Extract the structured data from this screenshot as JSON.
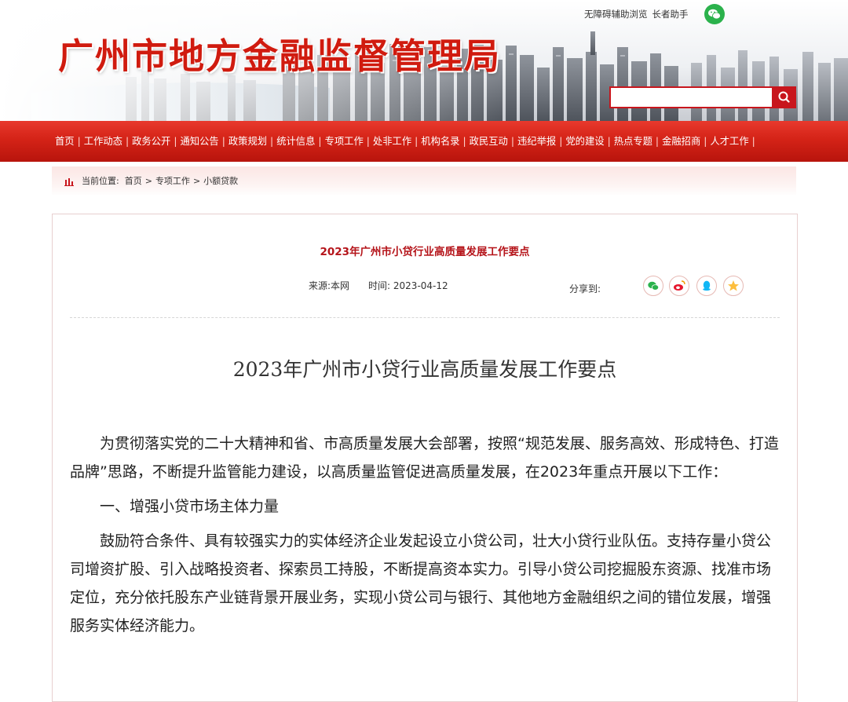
{
  "header": {
    "site_title": "广州市地方金融监督管理局",
    "accessibility_link": "无障碍辅助浏览",
    "elder_link": "长者助手",
    "wechat_icon": "wechat-icon",
    "search": {
      "value": "",
      "placeholder": "",
      "button_icon": "search-icon"
    }
  },
  "nav": {
    "items": [
      "首页",
      "工作动态",
      "政务公开",
      "通知公告",
      "政策规划",
      "统计信息",
      "专项工作",
      "处非工作",
      "机构名录",
      "政民互动",
      "违纪举报",
      "党的建设",
      "热点专题",
      "金融招商",
      "人才工作"
    ],
    "separator": "|"
  },
  "breadcrumb": {
    "label": "当前位置:",
    "items": [
      "首页",
      "专项工作",
      "小额贷款"
    ],
    "separator": ">"
  },
  "article": {
    "head_title": "2023年广州市小贷行业高质量发展工作要点",
    "source": "来源:本网",
    "time": "时间: 2023-04-12",
    "share_label": "分享到:",
    "share_icons": [
      "wechat-icon",
      "weibo-icon",
      "qq-icon",
      "qzone-icon"
    ],
    "doc_title": "2023年广州市小贷行业高质量发展工作要点",
    "paragraphs": [
      "为贯彻落实党的二十大精神和省、市高质量发展大会部署，按照“规范发展、服务高效、形成特色、打造品牌”思路，不断提升监管能力建设，以高质量监管促进高质量发展，在2023年重点开展以下工作：",
      "一、增强小贷市场主体力量",
      "鼓励符合条件、具有较强实力的实体经济企业发起设立小贷公司，壮大小贷行业队伍。支持存量小贷公司增资扩股、引入战略投资者、探索员工持股，不断提高资本实力。引导小贷公司挖掘股东资源、找准市场定位，充分依托股东产业链背景开展业务，实现小贷公司与银行、其他地方金融组织之间的错位发展，增强服务实体经济能力。"
    ]
  },
  "colors": {
    "brand_red": "#c8161d",
    "title_red": "#d01b0f",
    "article_head_red": "#b5141a",
    "wechat_green": "#2bb24c"
  }
}
